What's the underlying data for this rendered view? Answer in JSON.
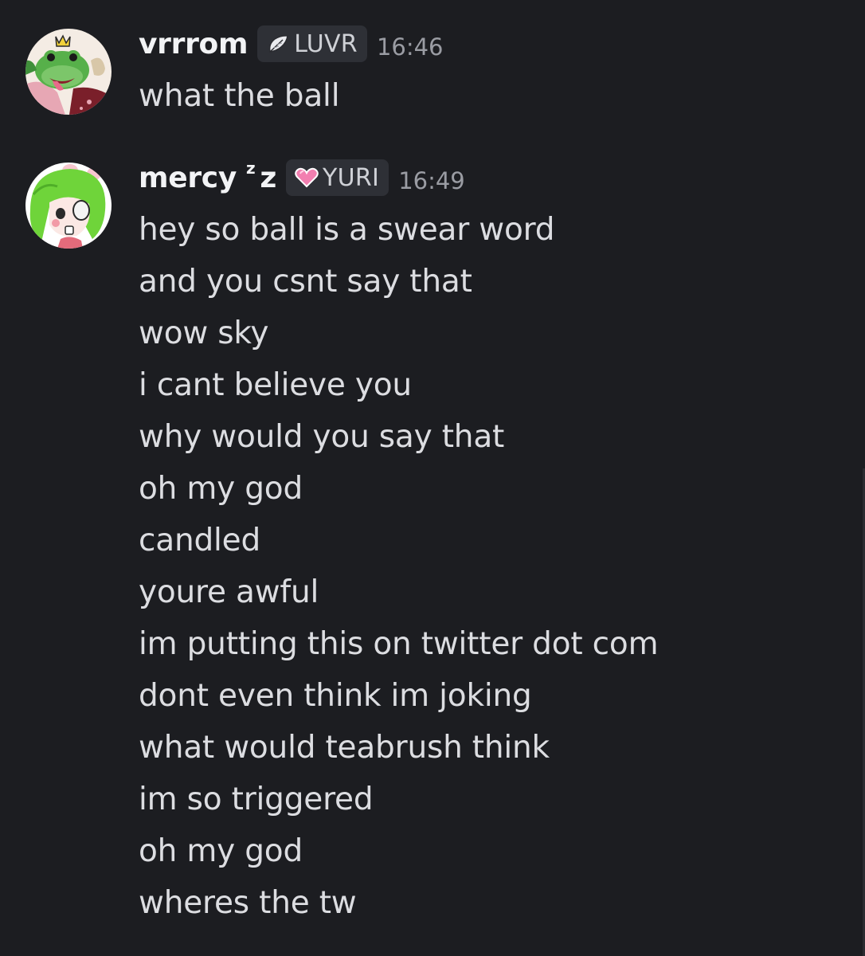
{
  "messages": [
    {
      "username": "vrrrom",
      "tag": {
        "label": "LUVR",
        "icon": "feather-icon"
      },
      "timestamp": "16:46",
      "lines": [
        "what the ball"
      ]
    },
    {
      "username": "mercy",
      "username_sup": "z",
      "username_suffix": "z",
      "tag": {
        "label": "YURI",
        "icon": "pink-heart-icon"
      },
      "timestamp": "16:49",
      "lines": [
        "hey so ball is a swear word",
        "and you csnt say that",
        "wow sky",
        "i cant believe you",
        "why would you say that",
        "oh my god",
        "candled",
        "youre awful",
        "im putting this on twitter dot com",
        "dont even think im joking",
        "what would teabrush think",
        "im so triggered",
        "oh my god",
        "wheres the tw"
      ]
    }
  ],
  "colors": {
    "background": "#1c1d21",
    "username": "#f2f3f5",
    "message_text": "#dcdde1",
    "timestamp": "#9a9ca3",
    "tag_background": "#2e3036",
    "heart": "#f27fb0"
  }
}
